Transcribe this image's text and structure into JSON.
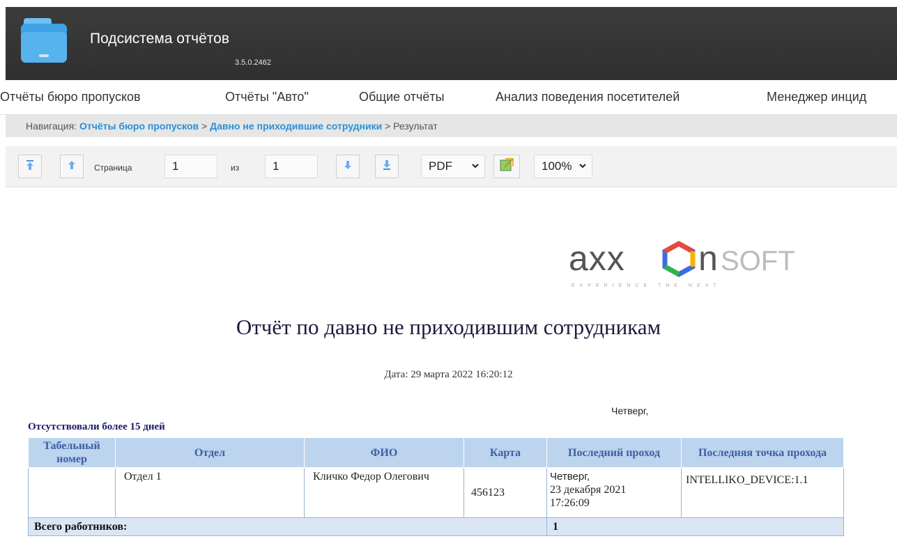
{
  "header": {
    "title": "Подсистема отчётов",
    "version": "3.5.0.2462"
  },
  "menu": {
    "items": [
      {
        "label": "Отчёты бюро пропусков"
      },
      {
        "label": "Отчёты \"Авто\""
      },
      {
        "label": "Общие отчёты"
      },
      {
        "label": "Анализ поведения посетителей"
      },
      {
        "label": "Менеджер инцид"
      }
    ]
  },
  "breadcrumb": {
    "prefix": "Навигация:",
    "link1": "Отчёты бюро пропусков",
    "sep1": ">",
    "link2": "Давно не приходившие сотрудники",
    "sep2": ">",
    "current": "Результат"
  },
  "toolbar": {
    "page_label": "Страница",
    "page_value": "1",
    "of_label": "из",
    "total_pages": "1",
    "format_value": "PDF",
    "zoom_value": "100%",
    "icons": [
      "first-page-icon",
      "prev-page-icon",
      "next-page-icon",
      "last-page-icon",
      "export-icon"
    ]
  },
  "report": {
    "logo_text": "axxonsoft",
    "logo_tagline": "EXPERIENCE THE NEXT",
    "title": "Отчёт по давно не приходившим сотрудникам",
    "date": "Дата: 29 марта 2022 16:20:12",
    "weekday": "Четверг,",
    "group_title": "Отсутствовали более 15 дней",
    "columns": [
      "Табельный номер",
      "Отдел",
      "ФИО",
      "Карта",
      "Последний проход",
      "Последняя точка прохода"
    ],
    "rows": [
      {
        "tab_number": "",
        "department": "Отдел 1",
        "name": "Кличко Федор Олегович",
        "card": "456123",
        "last_pass_day": "Четверг,",
        "last_pass_date": "23 декабря 2021",
        "last_pass_time": "17:26:09",
        "last_point": "INTELLIKO_DEVICE:1.1"
      }
    ],
    "total_label": "Всего работников:",
    "total_value": "1"
  },
  "colors": {
    "header_bg": "#333333",
    "link": "#2b8fd6",
    "table_header_bg": "#bcd4ee",
    "table_header_text": "#3a5fa3"
  }
}
